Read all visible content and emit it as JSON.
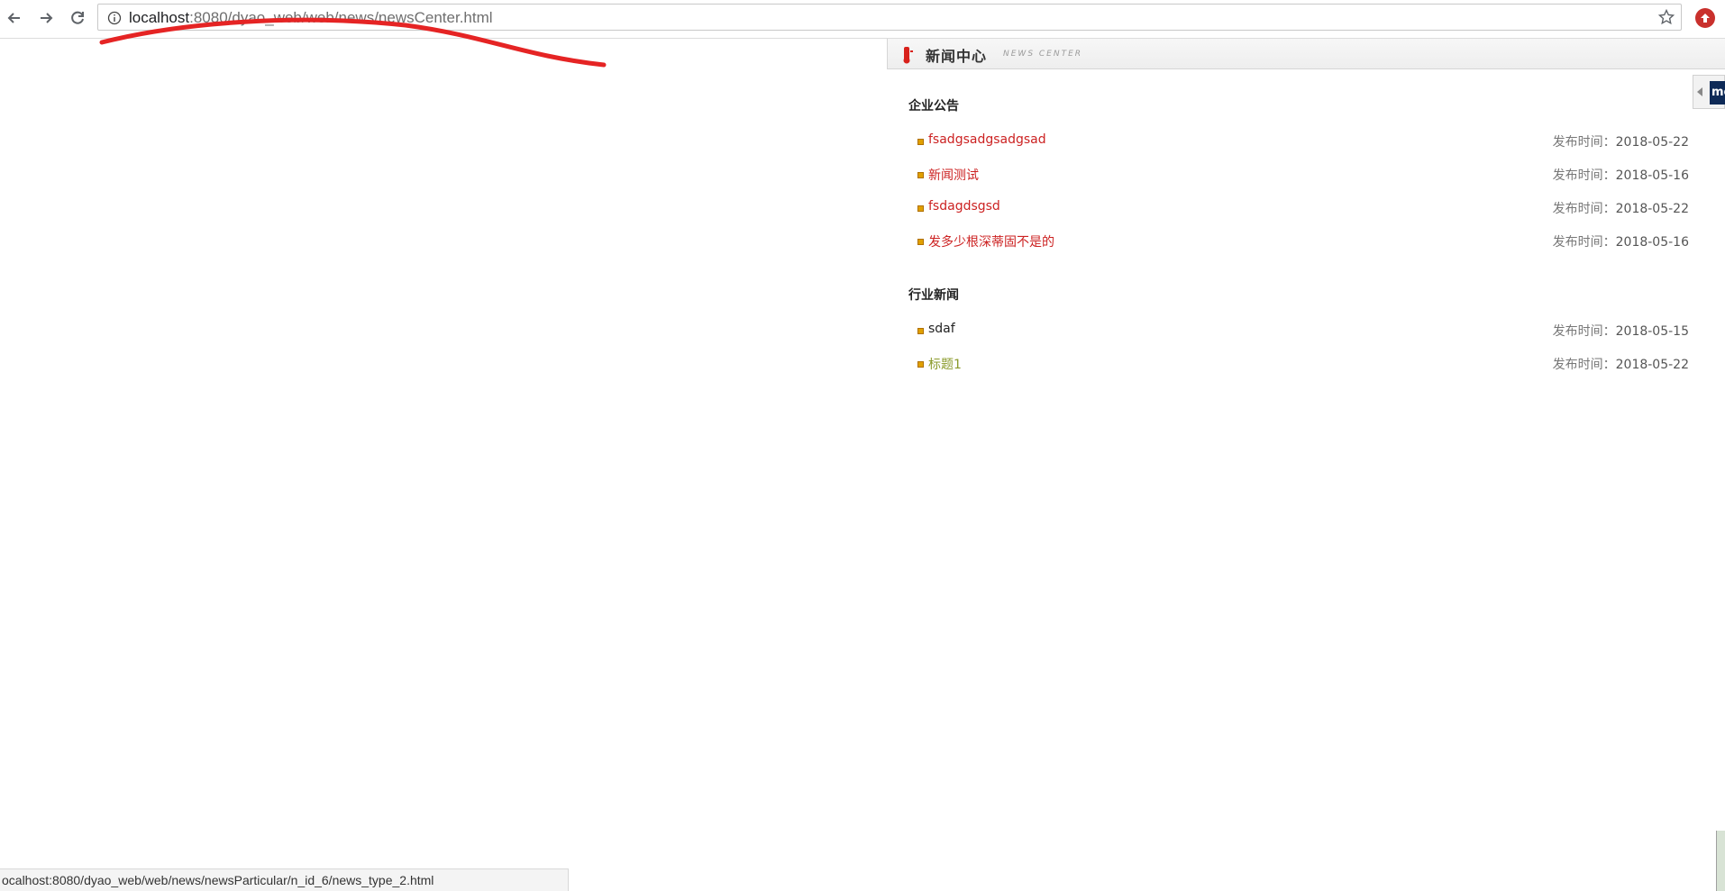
{
  "browser": {
    "url_host": "localhost",
    "url_rest": ":8080/dyao_web/web/news/newsCenter.html",
    "status_url": "ocalhost:8080/dyao_web/web/news/newsParticular/n_id_6/news_type_2.html"
  },
  "colors": {
    "link_red": "#cc2222",
    "link_olive": "#8a9a2a",
    "bullet": "#e0a000"
  },
  "news_center": {
    "title": "新闻中心",
    "subtitle": "NEWS CENTER",
    "sections": [
      {
        "title": "企业公告",
        "items": [
          {
            "title": "fsadgsadgsadgsad",
            "date_label": "发布时间：",
            "date": "2018-05-22",
            "color": "#cc2222"
          },
          {
            "title": "新闻测试",
            "date_label": "发布时间：",
            "date": "2018-05-16",
            "color": "#cc2222"
          },
          {
            "title": "fsdagdsgsd",
            "date_label": "发布时间：",
            "date": "2018-05-22",
            "color": "#cc2222"
          },
          {
            "title": "发多少根深蒂固不是的",
            "date_label": "发布时间：",
            "date": "2018-05-16",
            "color": "#cc2222"
          }
        ]
      },
      {
        "title": "行业新闻",
        "items": [
          {
            "title": "sdaf",
            "date_label": "发布时间：",
            "date": "2018-05-15",
            "color": "#222222"
          },
          {
            "title": "标题1",
            "date_label": "发布时间：",
            "date": "2018-05-22",
            "color": "#8a9a2a"
          }
        ]
      }
    ]
  },
  "side_tab": {
    "logo_text": "me"
  }
}
